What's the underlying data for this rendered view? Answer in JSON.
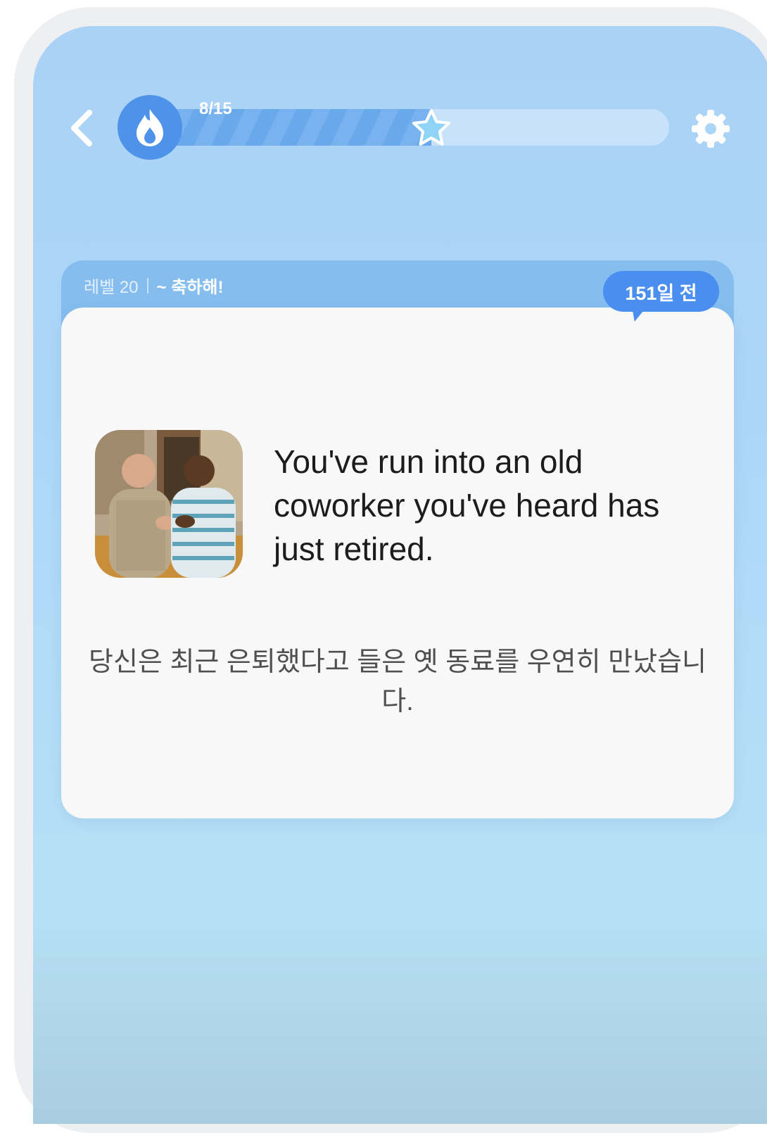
{
  "topbar": {
    "progress_label": "8/15",
    "progress_fraction": 0.533,
    "back_icon": "chevron-left-icon",
    "streak_icon": "flame-icon",
    "milestone_icon": "star-icon",
    "settings_icon": "gear-icon"
  },
  "card": {
    "level": "레벨 20",
    "congrats": "~ 축하해!",
    "days_ago": "151일 전",
    "scene_text": "You've run into an old coworker you've heard has just retired.",
    "translation": "당신은 최근 은퇴했다고 들은 옛 동료를 우연히 만났습니다."
  },
  "colors": {
    "accent": "#4e92ea",
    "card_header": "#84bdee",
    "background": "#acd6f8"
  }
}
